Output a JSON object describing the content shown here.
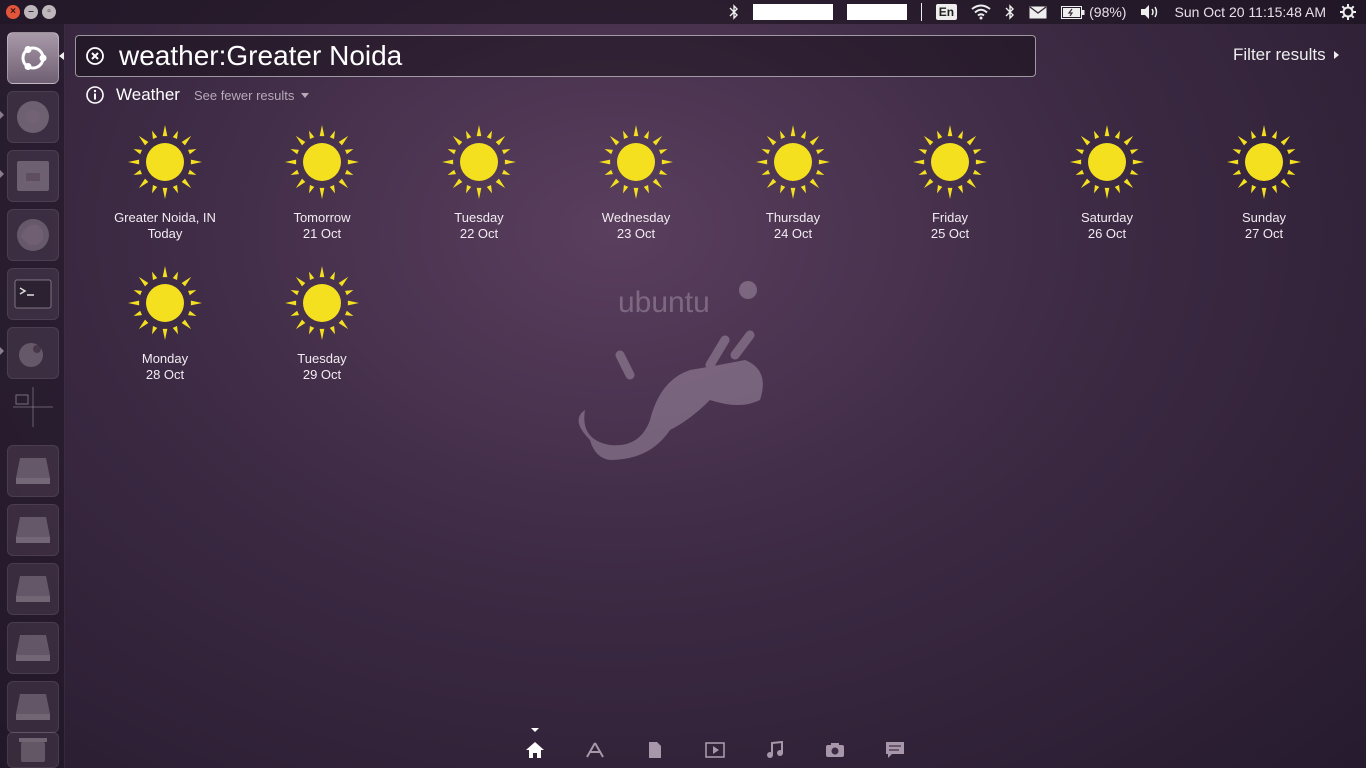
{
  "panel": {
    "lang": "En",
    "battery": "(98%)",
    "datetime": "Sun Oct 20  11:15:48 AM"
  },
  "search": {
    "query": "weather:Greater Noida",
    "filter_label": "Filter results"
  },
  "category": {
    "title": "Weather",
    "see_fewer": "See fewer results"
  },
  "forecast": [
    {
      "line1": "Greater Noida, IN",
      "line2": "Today",
      "icon": "sun-icon"
    },
    {
      "line1": "Tomorrow",
      "line2": "21 Oct",
      "icon": "sun-icon"
    },
    {
      "line1": "Tuesday",
      "line2": "22 Oct",
      "icon": "sun-icon"
    },
    {
      "line1": "Wednesday",
      "line2": "23 Oct",
      "icon": "sun-icon"
    },
    {
      "line1": "Thursday",
      "line2": "24 Oct",
      "icon": "sun-icon"
    },
    {
      "line1": "Friday",
      "line2": "25 Oct",
      "icon": "sun-icon"
    },
    {
      "line1": "Saturday",
      "line2": "26 Oct",
      "icon": "sun-icon"
    },
    {
      "line1": "Sunday",
      "line2": "27 Oct",
      "icon": "sun-icon"
    },
    {
      "line1": "Monday",
      "line2": "28 Oct",
      "icon": "sun-icon"
    },
    {
      "line1": "Tuesday",
      "line2": "29 Oct",
      "icon": "sun-icon"
    }
  ],
  "colors": {
    "sun": "#f5e020",
    "background": "#3d2a44",
    "close_button": "#e2553a"
  },
  "watermark_text": "ubuntu"
}
